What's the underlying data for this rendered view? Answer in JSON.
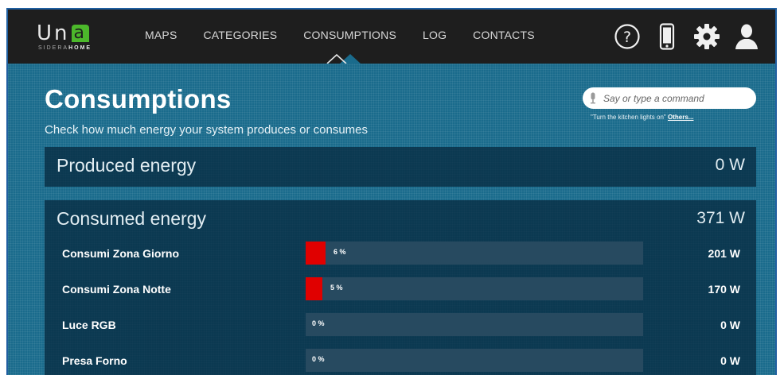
{
  "brand": {
    "wordmark_start": "Un",
    "wordmark_accent": "a",
    "sub_prefix": "SIDERA",
    "sub_bold": "HOME",
    "accent_color": "#4cb82b"
  },
  "nav": {
    "items": [
      {
        "label": "MAPS",
        "active": false
      },
      {
        "label": "CATEGORIES",
        "active": false
      },
      {
        "label": "CONSUMPTIONS",
        "active": true
      },
      {
        "label": "LOG",
        "active": false
      },
      {
        "label": "CONTACTS",
        "active": false
      }
    ]
  },
  "toolbar": {
    "icons": [
      "help-icon",
      "phone-icon",
      "gear-icon",
      "user-icon"
    ]
  },
  "page": {
    "title": "Consumptions",
    "subtitle": "Check how much energy your system produces or consumes"
  },
  "voice": {
    "placeholder": "Say or type a command",
    "hint": "\"Turn the kitchen lights on\"",
    "hint_link": "Others..."
  },
  "produced": {
    "title": "Produced energy",
    "value": "0 W"
  },
  "consumed": {
    "title": "Consumed energy",
    "value": "371 W",
    "bar_color": "#e00000",
    "rows": [
      {
        "label": "Consumi Zona Giorno",
        "percent": 6,
        "percent_label": "6 %",
        "value": "201 W"
      },
      {
        "label": "Consumi Zona Notte",
        "percent": 5,
        "percent_label": "5 %",
        "value": "170 W"
      },
      {
        "label": "Luce RGB",
        "percent": 0,
        "percent_label": "0 %",
        "value": "0 W"
      },
      {
        "label": "Presa Forno",
        "percent": 0,
        "percent_label": "0 %",
        "value": "0 W"
      }
    ]
  }
}
